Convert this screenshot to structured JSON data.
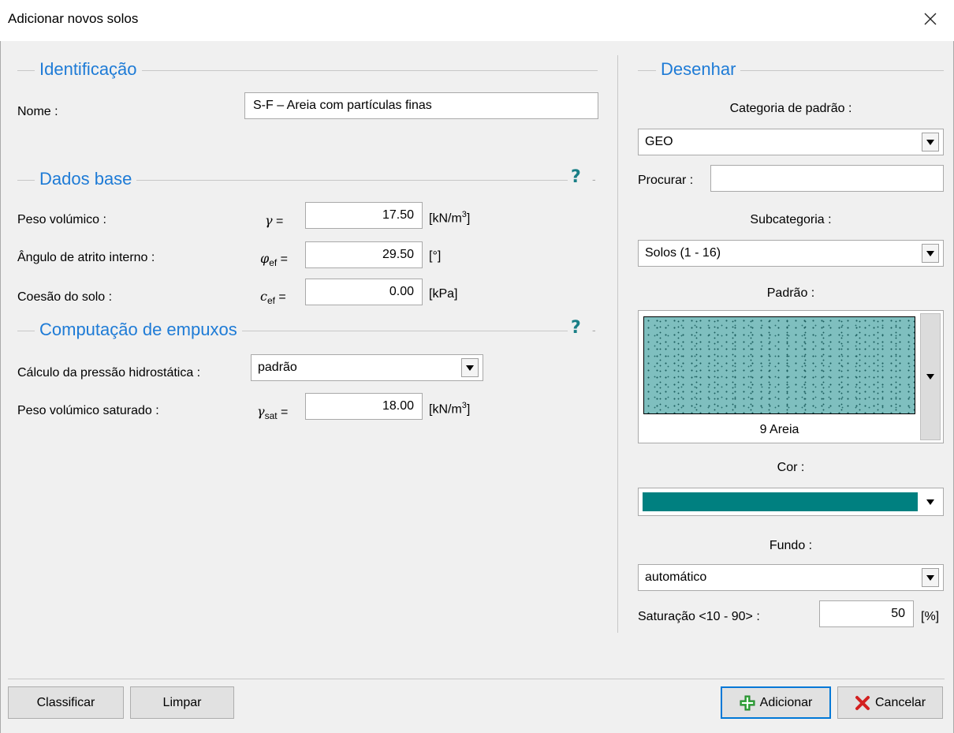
{
  "window": {
    "title": "Adicionar novos solos",
    "close_glyph": "✕"
  },
  "identificacao": {
    "title": "Identificação",
    "nome_label": "Nome :",
    "nome_value": "S-F – Areia com partículas finas"
  },
  "dados_base": {
    "title": "Dados base",
    "help": "?",
    "peso_volumico": {
      "label": "Peso volúmico  :",
      "symbol": "γ",
      "sub": "",
      "eq": " =",
      "value": "17.50",
      "unit": "[kN/m",
      "unit_sup": "3",
      "unit_end": "]"
    },
    "angulo_atrito": {
      "label": "Ângulo de atrito interno :",
      "symbol": "φ",
      "sub": "ef",
      "eq": " =",
      "value": "29.50",
      "unit": "[°]"
    },
    "coesao": {
      "label": "Coesão do solo :",
      "symbol": "c",
      "sub": "ef",
      "eq": " =",
      "value": "0.00",
      "unit": "[kPa]"
    }
  },
  "computacao": {
    "title": "Computação de empuxos",
    "help": "?",
    "calculo_label": "Cálculo da pressão hidrostática :",
    "calculo_value": "padrão",
    "peso_sat": {
      "label": "Peso volúmico saturado :",
      "symbol": "γ",
      "sub": "sat",
      "eq": " =",
      "value": "18.00",
      "unit": "[kN/m",
      "unit_sup": "3",
      "unit_end": "]"
    }
  },
  "desenhar": {
    "title": "Desenhar",
    "categoria_label": "Categoria de padrão :",
    "categoria_value": "GEO",
    "procurar_label": "Procurar :",
    "procurar_value": "",
    "subcategoria_label": "Subcategoria :",
    "subcategoria_value": "Solos (1 - 16)",
    "padrao_label": "Padrão :",
    "padrao_value": "9 Areia",
    "cor_label": "Cor :",
    "cor_value": "#008080",
    "pattern_color": "#7fbfbf",
    "fundo_label": "Fundo :",
    "fundo_value": "automático",
    "saturacao_label": "Saturação <10 - 90> :",
    "saturacao_value": "50",
    "saturacao_unit": "[%]"
  },
  "footer": {
    "classificar": "Classificar",
    "limpar": "Limpar",
    "adicionar": "Adicionar",
    "cancelar": "Cancelar"
  },
  "icons": {
    "add": "plus-icon",
    "cancel": "x-icon",
    "dropdown": "chevron-down-icon",
    "help": "help-icon",
    "close": "close-icon"
  }
}
